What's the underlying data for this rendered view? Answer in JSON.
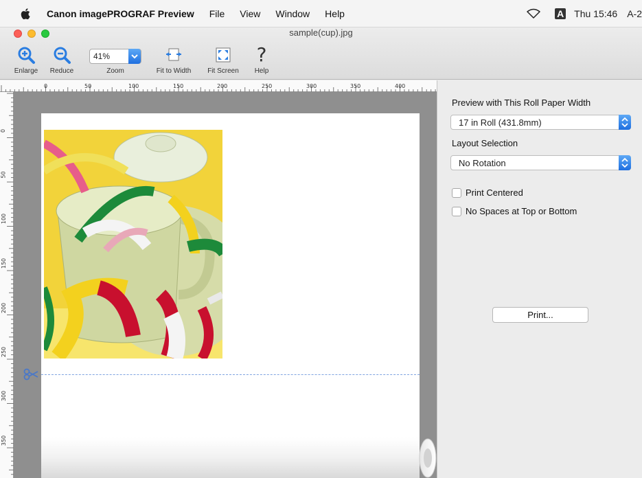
{
  "menubar": {
    "app_name": "Canon imagePROGRAF Preview",
    "menus": [
      "File",
      "View",
      "Window",
      "Help"
    ],
    "clock": "Thu 15:46",
    "user": "A-2",
    "input_badge": "A"
  },
  "window": {
    "title": "sample(cup).jpg"
  },
  "toolbar": {
    "enlarge_label": "Enlarge",
    "reduce_label": "Reduce",
    "zoom_label": "Zoom",
    "zoom_value": "41%",
    "fit_width_label": "Fit to Width",
    "fit_screen_label": "Fit Screen",
    "help_label": "Help",
    "help_glyph": "?"
  },
  "ruler": {
    "top_ticks": [
      "0",
      "50",
      "100",
      "150",
      "200",
      "250",
      "300",
      "350",
      "400"
    ],
    "left_ticks": [
      "0",
      "50",
      "100",
      "150",
      "200",
      "250",
      "300",
      "350"
    ]
  },
  "panel": {
    "roll_width_label": "Preview with This Roll Paper Width",
    "roll_width_value": "17 in Roll (431.8mm)",
    "layout_label": "Layout Selection",
    "layout_value": "No Rotation",
    "print_centered_label": "Print Centered",
    "no_spaces_label": "No Spaces at Top or Bottom",
    "print_button": "Print..."
  },
  "colors": {
    "accent_blue": "#1f6fe0",
    "tape_yellow": "#f4d21f",
    "tape_red": "#c8102e",
    "tape_green": "#1d8a3a",
    "cup_green": "#c9d39c"
  }
}
